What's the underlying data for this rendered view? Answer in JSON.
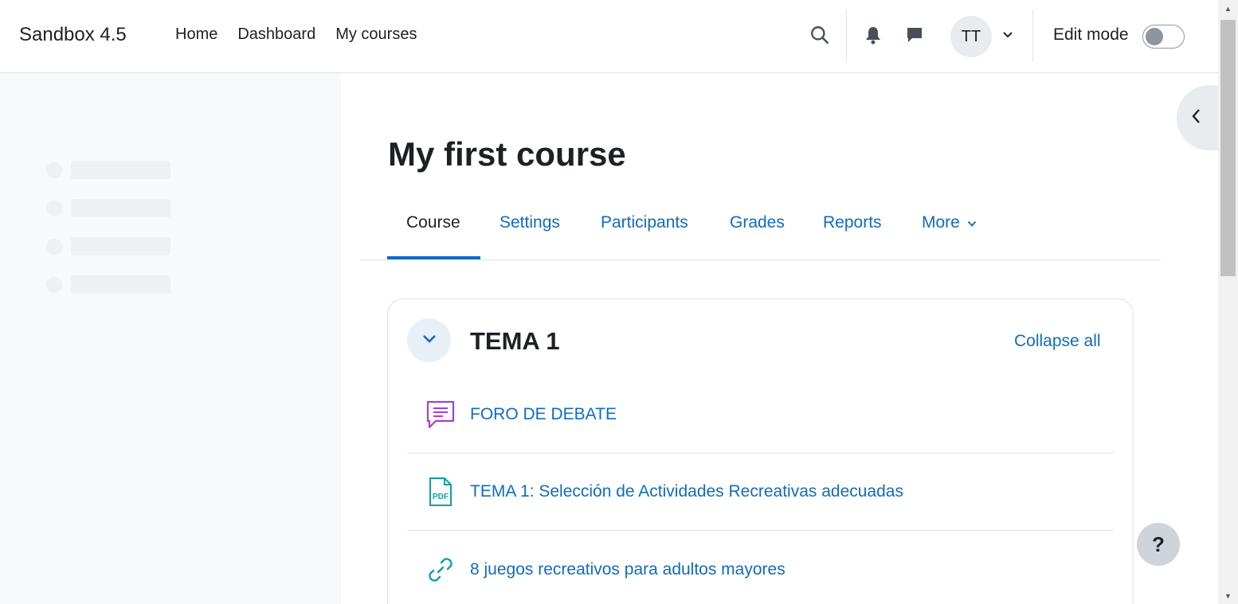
{
  "navbar": {
    "brand": "Sandbox 4.5",
    "links": [
      "Home",
      "Dashboard",
      "My courses"
    ],
    "user_initials": "TT",
    "edit_mode_label": "Edit mode",
    "edit_mode_on": false
  },
  "page": {
    "title": "My first course",
    "tabs": [
      "Course",
      "Settings",
      "Participants",
      "Grades",
      "Reports",
      "More"
    ],
    "active_tab": "Course"
  },
  "section": {
    "title": "TEMA 1",
    "collapse_all": "Collapse all",
    "activities": [
      {
        "name": "FORO DE DEBATE",
        "icon": "forum-icon",
        "color": "#a341d8"
      },
      {
        "name": "TEMA 1: Selección de Actividades Recreativas adecuadas",
        "icon": "pdf-icon",
        "color": "#0d9fa7"
      },
      {
        "name": "8 juegos recreativos para adultos mayores",
        "icon": "link-icon",
        "color": "#0d9fa7"
      }
    ]
  },
  "help": "?",
  "colors": {
    "link": "#0f6cbf",
    "text": "#1d2125",
    "drawer_bg": "#f8f9fa"
  }
}
